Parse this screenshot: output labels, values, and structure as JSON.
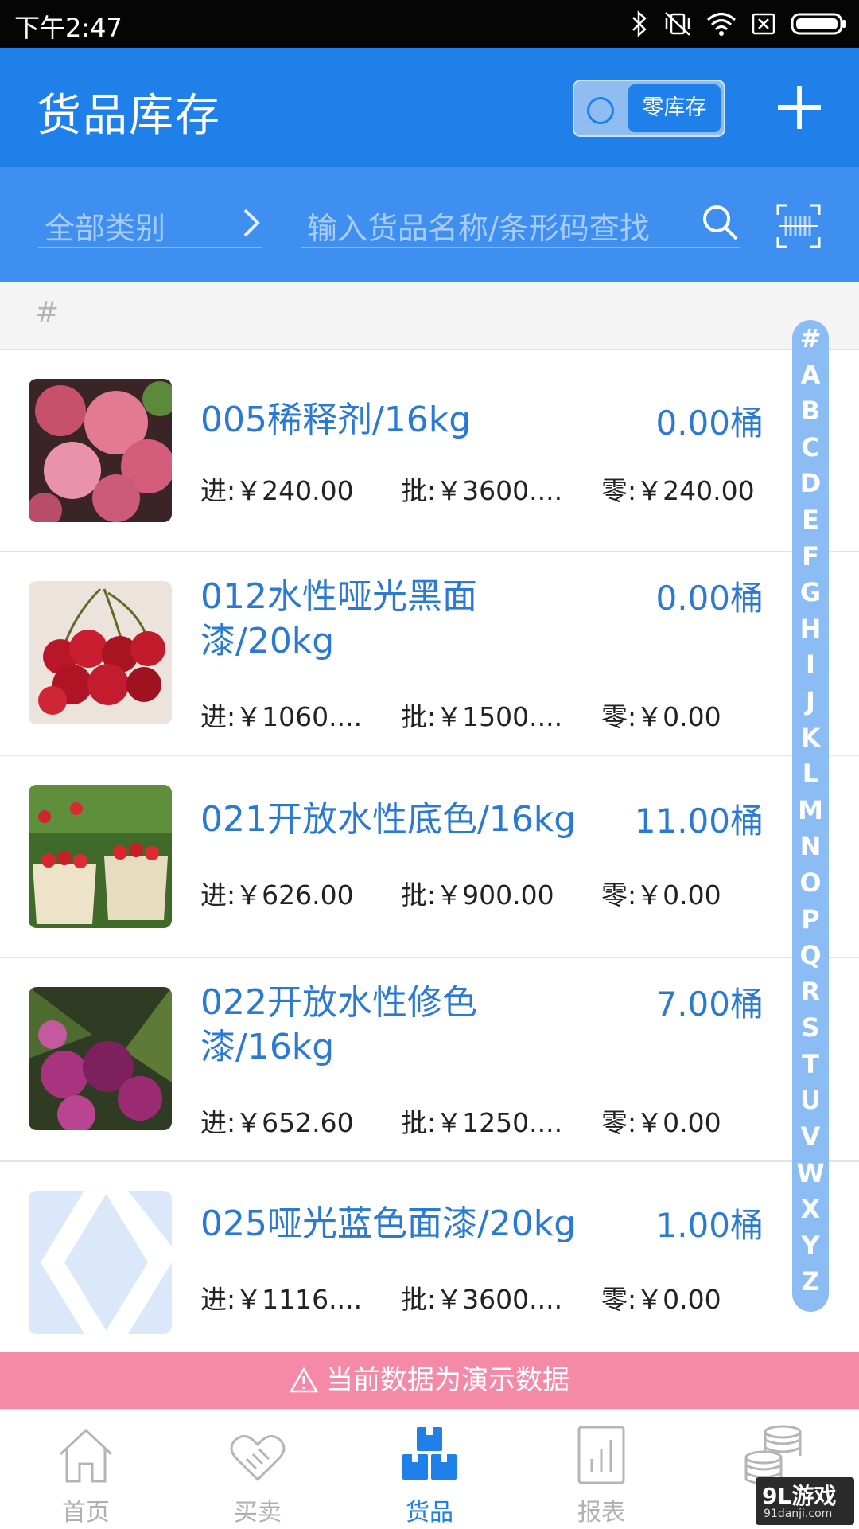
{
  "status_bar": {
    "time": "下午2:47"
  },
  "header": {
    "title": "货品库存",
    "zero_stock_toggle_label": "零库存"
  },
  "filter": {
    "category_label": "全部类别",
    "search_placeholder": "输入货品名称/条形码查找"
  },
  "section_header": "#",
  "items": [
    {
      "name": "005稀释剂/16kg",
      "qty": "0.00桶",
      "in_price": "进:￥240.00",
      "wholesale_price": "批:￥3600....",
      "retail_price": "零:￥240.00",
      "image": "lychee-photo"
    },
    {
      "name": "012水性哑光黑面漆/20kg",
      "qty": "0.00桶",
      "in_price": "进:￥1060....",
      "wholesale_price": "批:￥1500....",
      "retail_price": "零:￥0.00",
      "image": "cherries-photo"
    },
    {
      "name": "021开放水性底色/16kg",
      "qty": "11.00桶",
      "in_price": "进:￥626.00",
      "wholesale_price": "批:￥900.00",
      "retail_price": "零:￥0.00",
      "image": "cherry-baskets-photo"
    },
    {
      "name": "022开放水性修色漆/16kg",
      "qty": "7.00桶",
      "in_price": "进:￥652.60",
      "wholesale_price": "批:￥1250....",
      "retail_price": "零:￥0.00",
      "image": "bayberry-photo"
    },
    {
      "name": "025哑光蓝色面漆/20kg",
      "qty": "1.00桶",
      "in_price": "进:￥1116....",
      "wholesale_price": "批:￥3600....",
      "retail_price": "零:￥0.00",
      "image": "placeholder-logo"
    }
  ],
  "alphabet_index": [
    "#",
    "A",
    "B",
    "C",
    "D",
    "E",
    "F",
    "G",
    "H",
    "I",
    "J",
    "K",
    "L",
    "M",
    "N",
    "O",
    "P",
    "Q",
    "R",
    "S",
    "T",
    "U",
    "V",
    "W",
    "X",
    "Y",
    "Z"
  ],
  "demo_banner": "当前数据为演示数据",
  "tabs": [
    {
      "label": "首页",
      "icon": "home-icon",
      "active": false
    },
    {
      "label": "买卖",
      "icon": "handshake-icon",
      "active": false
    },
    {
      "label": "货品",
      "icon": "boxes-icon",
      "active": true
    },
    {
      "label": "报表",
      "icon": "chart-icon",
      "active": false
    },
    {
      "label": "",
      "icon": "coins-icon",
      "active": false
    }
  ],
  "watermark": {
    "brand": "9L游戏",
    "url": "91danji.com"
  },
  "colors": {
    "primary": "#2080ea",
    "filter_bar": "#3f8ff0",
    "banner": "#f48aa8",
    "item_blue": "#2a7ad4"
  }
}
